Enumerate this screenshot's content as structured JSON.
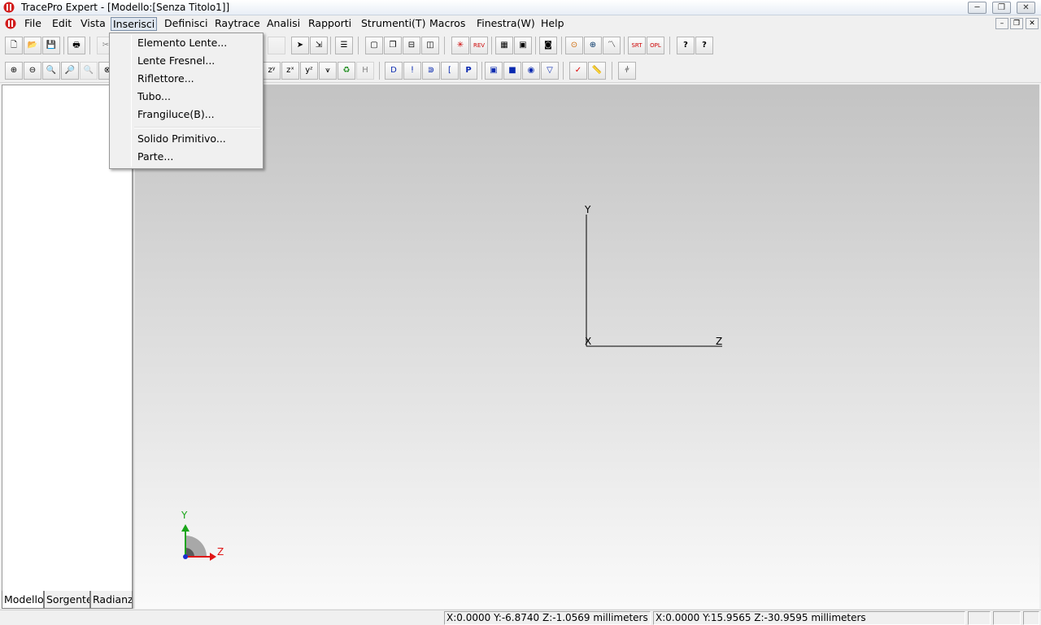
{
  "window": {
    "title": "TracePro Expert - [Modello:[Senza Titolo1]]",
    "minimize_glyph": "─",
    "maximize_glyph": "❐",
    "close_glyph": "✕",
    "mdi_minimize_glyph": "–",
    "mdi_restore_glyph": "❐",
    "mdi_close_glyph": "✕"
  },
  "menubar": {
    "items": [
      {
        "label": "File"
      },
      {
        "label": "Edit"
      },
      {
        "label": "Vista"
      },
      {
        "label": "Inserisci"
      },
      {
        "label": "Definisci"
      },
      {
        "label": "Raytrace"
      },
      {
        "label": "Analisi"
      },
      {
        "label": "Rapporti"
      },
      {
        "label": "Strumenti(T)"
      },
      {
        "label": "Macros"
      },
      {
        "label": "Finestra(W)"
      },
      {
        "label": "Help"
      }
    ]
  },
  "dropdown": {
    "items": [
      {
        "label": "Elemento Lente..."
      },
      {
        "label": "Lente Fresnel..."
      },
      {
        "label": "Riflettore..."
      },
      {
        "label": "Tubo..."
      },
      {
        "label": "Frangiluce(B)..."
      },
      {
        "label": "Solido Primitivo..."
      },
      {
        "label": "Parte..."
      }
    ]
  },
  "toolbar1": {
    "icons": [
      "new-file-icon",
      "open-folder-icon",
      "save-icon",
      "print-icon",
      "cut-icon",
      "placeholder-icon",
      "select-arrow-icon",
      "select-surface-icon",
      "properties-list-icon",
      "window-single-icon",
      "window-cascade-icon",
      "window-horizontal-icon",
      "window-vertical-icon",
      "trace-rays-icon",
      "rev-icon",
      "grid-map-icon",
      "irradiance-map-icon",
      "candela-icon",
      "source-icon",
      "target-icon",
      "chart-icon",
      "srt-icon",
      "opl-icon",
      "help-icon",
      "context-help-icon"
    ],
    "glyphs": {
      "new": "🗋",
      "open": "📂",
      "save": "💾",
      "print": "🖶",
      "cut": "✂",
      "select": "➤",
      "select_surface": "⇲",
      "list": "☰",
      "w1": "▢",
      "w2": "❐",
      "w3": "⊟",
      "w4": "◫",
      "trace": "✳",
      "rev": "REV",
      "grid": "▦",
      "irr": "▣",
      "cand": "◙",
      "src": "⊙",
      "tgt": "⊕",
      "chart": "〽",
      "srt": "SRT",
      "opl": "OPL",
      "help": "?",
      "ctx_help": "?"
    }
  },
  "toolbar2": {
    "glyphs": {
      "zoom_in": "⊕",
      "zoom_out": "⊖",
      "zoom_window": "🔍",
      "zoom_all": "🔎",
      "zoom_dis": "🔍",
      "zoom_x": "⊗",
      "v_zy": "zʸ",
      "v_zx": "zˣ",
      "v_yz": "yᶻ",
      "v_iso": "⩛",
      "rotate": "♻",
      "h": "H",
      "d1": "D",
      "d2": "ⵑ",
      "d3": "⋑",
      "c": "[",
      "p": "P",
      "box": "▣",
      "sq": "■",
      "ring": "◉",
      "tri": "▽",
      "check": "✓",
      "ruler": "📏",
      "axes": "⫩"
    }
  },
  "left_panel": {
    "tabs": [
      {
        "label": "Modello"
      },
      {
        "label": "Sorgente"
      },
      {
        "label": "Radianz"
      }
    ]
  },
  "viewport": {
    "axis_labels": {
      "y": "Y",
      "x": "X",
      "z": "Z"
    },
    "triad_labels": {
      "y": "Y",
      "z": "Z"
    }
  },
  "status": {
    "cursor_coords": "X:0.0000 Y:-6.8740 Z:-1.0569 millimeters",
    "view_coords": "X:0.0000 Y:15.9565 Z:-30.9595 millimeters"
  }
}
